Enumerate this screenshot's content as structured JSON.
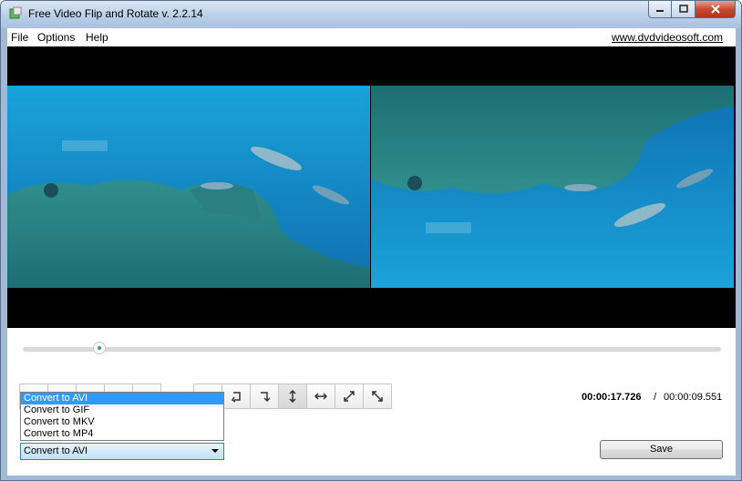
{
  "window": {
    "title": "Free Video Flip and Rotate v. 2.2.14"
  },
  "menu": {
    "file": "File",
    "options": "Options",
    "help": "Help",
    "site_link": "www.dvdvideosoft.com"
  },
  "player": {
    "progress": 0.11
  },
  "time": {
    "current": "00:00:17.726",
    "separator": "/",
    "total": "00:00:09.551"
  },
  "toolbar": {
    "left_buttons": [
      "blank",
      "blank",
      "blank",
      "blank",
      "blank"
    ],
    "right_buttons": [
      "rotate-left-icon",
      "rotate-ccw-icon",
      "rotate-cw-icon",
      "flip-vertical-icon",
      "flip-horizontal-icon",
      "diagonal-flip-icon",
      "diagonal-flip-alt-icon"
    ],
    "active": "flip-vertical-icon"
  },
  "format": {
    "selected": "Convert to AVI",
    "options": [
      "Convert to AVI",
      "Convert to GIF",
      "Convert to MKV",
      "Convert to MP4"
    ]
  },
  "save_label": "Save",
  "colors": {
    "accent": "#3399ff",
    "video_bg": "#000000",
    "water": "#1f9fd6"
  }
}
